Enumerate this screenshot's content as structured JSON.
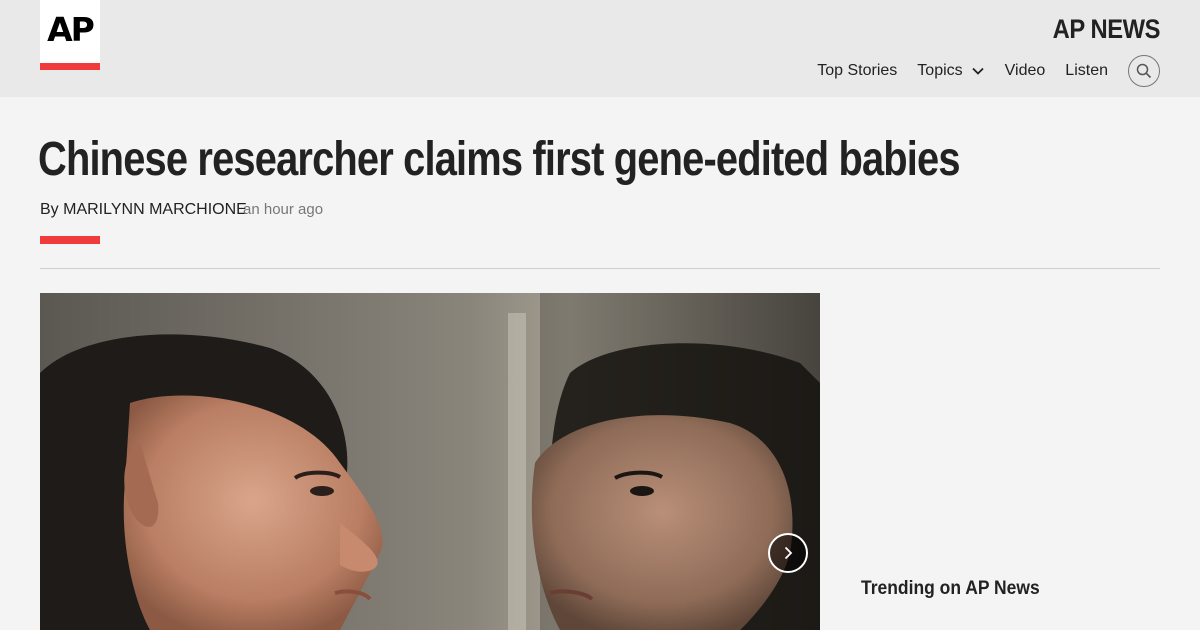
{
  "header": {
    "logo_text": "AP",
    "brand": "AP NEWS",
    "nav": [
      {
        "label": "Top Stories"
      },
      {
        "label": "Topics"
      },
      {
        "label": "Video"
      },
      {
        "label": "Listen"
      }
    ],
    "search_icon": "search-icon"
  },
  "article": {
    "headline": "Chinese researcher claims first gene-edited babies",
    "byline_prefix": "By",
    "author": "MARILYNN MARCHIONE",
    "timestamp": "an hour ago"
  },
  "gallery": {
    "next_icon": "chevron-right-icon"
  },
  "sidebar": {
    "trending_title": "Trending on AP News"
  },
  "colors": {
    "accent_red": "#ef3b3b",
    "header_bg": "#e9e9e9",
    "page_bg": "#f4f4f4"
  }
}
